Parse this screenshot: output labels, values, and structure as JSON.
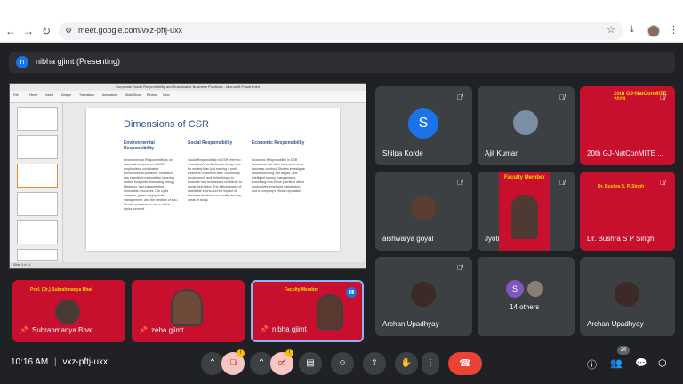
{
  "browser": {
    "url": "meet.google.com/vxz-pftj-uxx",
    "icons": [
      "back-arrow-icon",
      "forward-arrow-icon",
      "reload-icon",
      "tune-icon",
      "star-icon",
      "download-icon",
      "profile-icon",
      "menu-icon"
    ]
  },
  "presenter": {
    "avatar_letter": "n",
    "label": "nibha gjimt (Presenting)"
  },
  "presentation": {
    "window_title": "Corporate Social Responsibility and Sustainable Business Practices - Microsoft PowerPoint",
    "ribbon_tabs": [
      "File",
      "Home",
      "Insert",
      "Design",
      "Transitions",
      "Animations",
      "Slide Show",
      "Review",
      "View"
    ],
    "slide_title": "Dimensions of CSR",
    "columns": [
      {
        "heading": "Environmental Responsibility",
        "body": "Environmental Responsibility is an essential component of CSR, emphasizing sustainable environmental practices. Research has examined methods for lowering carbon footprints, increasing energy efficiency, and implementing renewable resources. Life cycle analyses, green supply chain management, and the creation of eco-friendly products are some of the topics covered."
      },
      {
        "heading": "Social Responsibility",
        "body": "Social Responsibility in CSR refers to a business's dedication to doing more for society than just earning a profit. Research examines staff, community involvement, and philanthropy to evaluate how businesses contribute to social well-being. The effectiveness of charitable efforts and the impact of business decisions on society are key areas of study."
      },
      {
        "heading": "Economic Responsibility",
        "body": "Economic Responsibility in CSR focuses on fair labor laws and moral business conduct. Studies investigate ethical sourcing, fair wages, and intelligent money management, examining how these practices affect productivity, employee satisfaction, and a company's ethical reputation."
      }
    ],
    "status": "Slide 3 of 14"
  },
  "grid_tiles": [
    {
      "name": "Shilpa Korde",
      "kind": "letter",
      "letter": "S"
    },
    {
      "name": "Ajit Kumar",
      "kind": "photo"
    },
    {
      "name": "20th GJ-NatConMITE ...",
      "kind": "banner",
      "banner": "20th GJ-NatConMITE 2024"
    },
    {
      "name": "aishwarya goyal",
      "kind": "photo"
    },
    {
      "name": "Jyoti",
      "kind": "banner-photo",
      "banner": "Faculty Member"
    },
    {
      "name": "Dr. Bushra S P Singh",
      "kind": "banner",
      "banner": "Dr. Bushra S. P. Singh"
    },
    {
      "name": "Archan Upadhyay",
      "kind": "photo"
    },
    {
      "name": "14 others",
      "kind": "others",
      "letter": "S"
    },
    {
      "name": "Archan Upadhyay",
      "kind": "photo"
    }
  ],
  "bottom_tiles": [
    {
      "name": "Subrahmanya Bhat",
      "banner": "Prof. (Dr.) Subrahmanya Bhat"
    },
    {
      "name": "zeba gjimt",
      "banner": ""
    },
    {
      "name": "nibha gjimt",
      "banner": "Faculty Member"
    }
  ],
  "meeting": {
    "time": "10:16 AM",
    "separator": "|",
    "code": "vxz-pftj-uxx",
    "people_count": "26"
  },
  "controls": {
    "mic_badge": "!",
    "cam_badge": "!",
    "icons": [
      "chevron-up-icon",
      "mic-off-icon",
      "chevron-up-icon",
      "camera-off-icon",
      "captions-icon",
      "emoji-icon",
      "present-icon",
      "raise-hand-icon",
      "more-options-icon",
      "end-call-icon",
      "info-icon",
      "people-icon",
      "chat-icon",
      "activities-icon"
    ]
  },
  "colors": {
    "meet_bg": "#202124",
    "tile_bg": "#3c4043",
    "end_call": "#ea4335",
    "accent": "#1a73e8",
    "banner_red": "#c8102e"
  }
}
